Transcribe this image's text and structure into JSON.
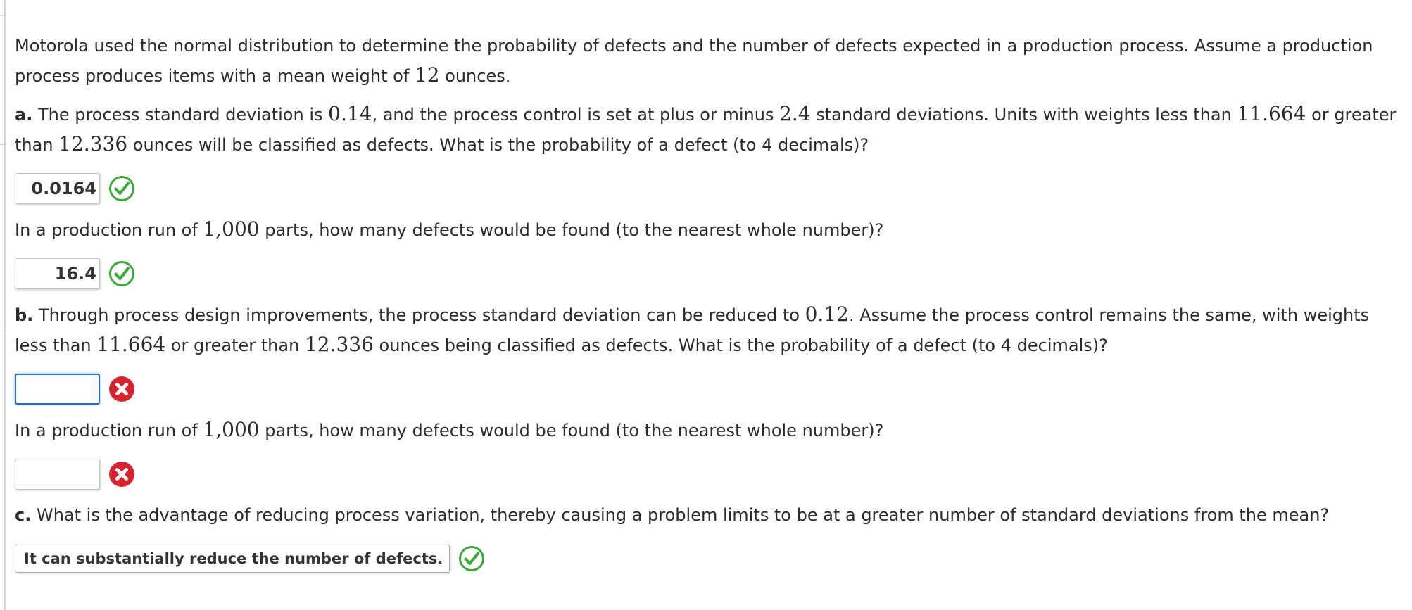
{
  "intro": {
    "t1": "Motorola used the normal distribution to determine the probability of defects and the number of defects expected in a production process. Assume a production process produces items with a mean weight of ",
    "mean": "12",
    "t2": " ounces."
  },
  "part_a": {
    "letter": "a.",
    "t1": " The process standard deviation is ",
    "sd": "0.14",
    "t2": ", and the process control is set at plus or minus ",
    "k": "2.4",
    "t3": " standard deviations. Units with weights less than ",
    "lower": "11.664",
    "t4": " or greater than ",
    "upper": "12.336",
    "t5": " ounces will be classified as defects. What is the probability of a defect (to 4 decimals)?",
    "prob_answer": "0.0164",
    "prob_status": "correct",
    "run_t1": "In a production run of ",
    "run_n": "1,000",
    "run_t2": " parts, how many defects would be found (to the nearest whole number)?",
    "count_answer": "16.4",
    "count_status": "correct"
  },
  "part_b": {
    "letter": "b.",
    "t1": " Through process design improvements, the process standard deviation can be reduced to ",
    "sd": "0.12",
    "t2": ". Assume the process control remains the same, with weights less than ",
    "lower": "11.664",
    "t3": " or greater than ",
    "upper": "12.336",
    "t4": " ounces being classified as defects. What is the probability of a defect (to 4 decimals)?",
    "prob_answer": "",
    "prob_status": "incorrect",
    "run_t1": "In a production run of ",
    "run_n": "1,000",
    "run_t2": " parts, how many defects would be found (to the nearest whole number)?",
    "count_answer": "",
    "count_status": "incorrect"
  },
  "part_c": {
    "letter": "c.",
    "t1": " What is the advantage of reducing process variation, thereby causing a problem limits to be at a greater number of standard deviations from the mean?",
    "selected": "It can substantially reduce the number of defects.",
    "status": "correct"
  },
  "icons": {
    "correct": "check-circle-icon",
    "incorrect": "x-circle-icon",
    "dropdown": "chevron-down-icon"
  },
  "colors": {
    "correct_green": "#3aa935",
    "incorrect_red": "#d6232e",
    "focus_blue": "#1f6fd1"
  }
}
